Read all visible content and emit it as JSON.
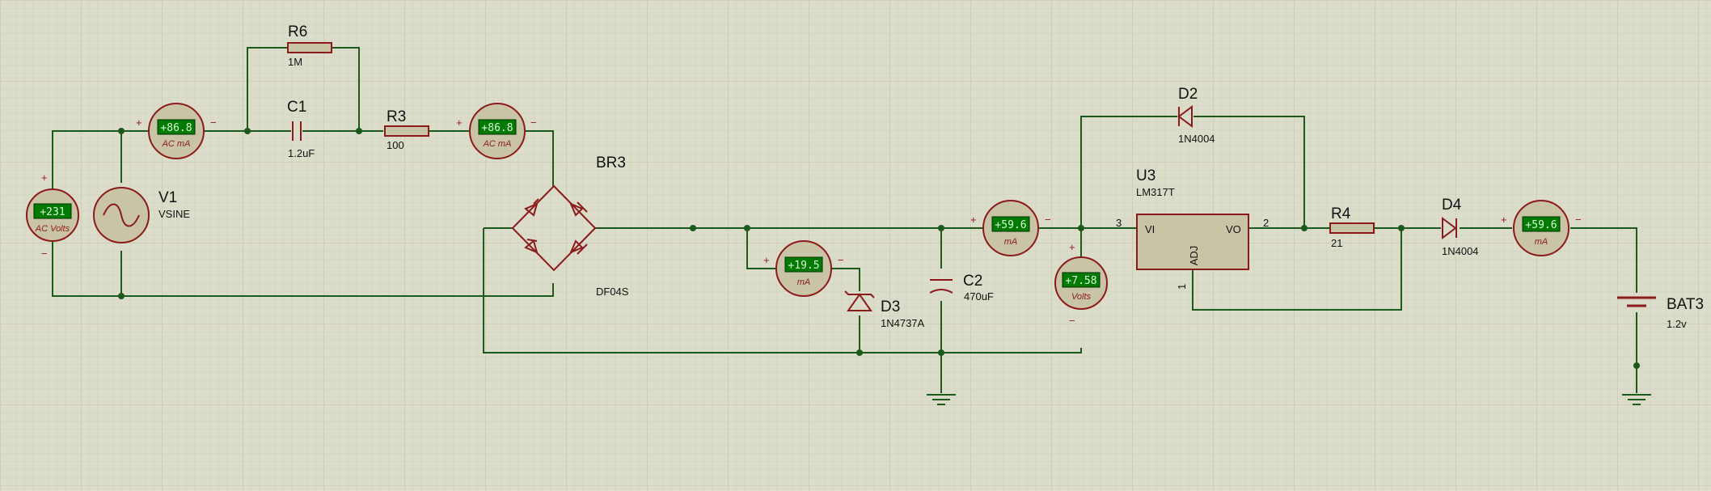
{
  "components": {
    "r6": {
      "ref": "R6",
      "value": "1M"
    },
    "c1": {
      "ref": "C1",
      "value": "1.2uF"
    },
    "r3": {
      "ref": "R3",
      "value": "100"
    },
    "v1": {
      "ref": "V1",
      "value": "VSINE"
    },
    "br3": {
      "ref": "BR3",
      "value": "DF04S"
    },
    "d3": {
      "ref": "D3",
      "value": "1N4737A"
    },
    "c2": {
      "ref": "C2",
      "value": "470uF"
    },
    "d2": {
      "ref": "D2",
      "value": "1N4004"
    },
    "u3": {
      "ref": "U3",
      "value": "LM317T",
      "pin_vi": "VI",
      "pin_vo": "VO",
      "pin_adj": "ADJ",
      "pin3": "3",
      "pin2": "2",
      "pin1": "1"
    },
    "r4": {
      "ref": "R4",
      "value": "21"
    },
    "d4": {
      "ref": "D4",
      "value": "1N4004"
    },
    "bat3": {
      "ref": "BAT3",
      "value": "1.2v"
    }
  },
  "meters": {
    "vm_ac": {
      "reading": "+231",
      "unit": "AC Volts"
    },
    "am1": {
      "reading": "+86.8",
      "unit": "AC mA"
    },
    "am2": {
      "reading": "+86.8",
      "unit": "AC mA"
    },
    "am3": {
      "reading": "+19.5",
      "unit": "mA"
    },
    "am4": {
      "reading": "+59.6",
      "unit": "mA"
    },
    "vm_dc": {
      "reading": "+7.58",
      "unit": "Volts"
    },
    "am5": {
      "reading": "+59.6",
      "unit": "mA"
    }
  },
  "polarity": {
    "plus": "+",
    "minus": "−"
  },
  "colors": {
    "background": "#dcdccb",
    "grid": "#c9c9b6",
    "wire": "#1c5a1c",
    "component": "#8b1a1a",
    "component_fill": "#c8c4a5",
    "meter_display": "#007a00"
  }
}
